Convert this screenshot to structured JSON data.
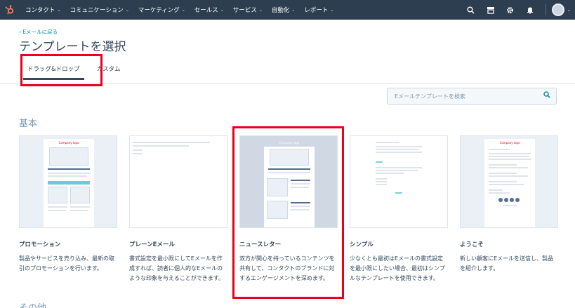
{
  "nav": {
    "items": [
      "コンタクト",
      "コミュニケーション",
      "マーケティング",
      "セールス",
      "サービス",
      "自動化",
      "レポート"
    ]
  },
  "header": {
    "back_link": "‹ Eメールに戻る",
    "title": "テンプレートを選択",
    "tabs": [
      "ドラッグ&ドロップ",
      "カスタム"
    ]
  },
  "search": {
    "placeholder": "Eメールテンプレートを検索"
  },
  "sections": {
    "basic": "基本",
    "other": "その他"
  },
  "cards": [
    {
      "title": "プロモーション",
      "desc": "製品やサービスを売り込み、最新の取引のプロモーションを行います。",
      "logo": "Company logo"
    },
    {
      "title": "プレーンEメール",
      "desc": "書式設定を最小限にしてEメールを作成すれば、読者に個人的なEメールのような印象を与えることができます。"
    },
    {
      "title": "ニュースレター",
      "desc": "双方が関心を持っているコンテンツを共有して、コンタクトのブランドに対するエンゲージメントを深めます。",
      "logo": "Company logo"
    },
    {
      "title": "シンプル",
      "desc": "少なくとも最初はEメールの書式設定を最小限にしたい場合、最初はシンプルなテンプレートを使用できます。"
    },
    {
      "title": "ようこそ",
      "desc": "新しい顧客にEメールを送信し、製品を紹介します。",
      "logo": "Company logo"
    }
  ],
  "colors": {
    "nav_bg": "#2d3e50",
    "accent": "#0091ae",
    "highlight": "#e8001f"
  }
}
